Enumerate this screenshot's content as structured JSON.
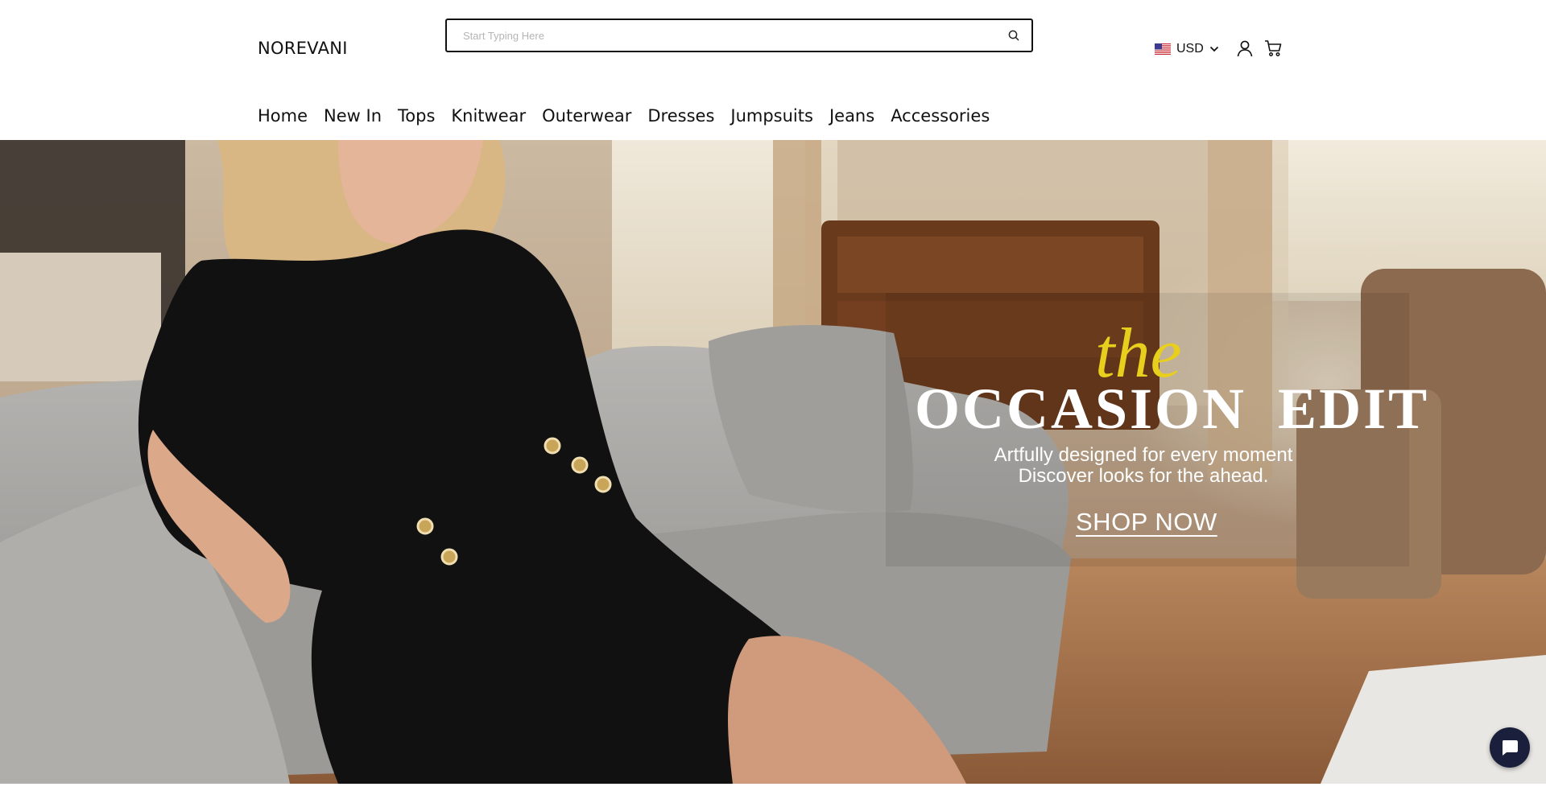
{
  "header": {
    "logo": "NOREVANI",
    "search": {
      "placeholder": "Start Typing Here",
      "value": "",
      "icon": "search-icon"
    },
    "currency": {
      "label": "USD",
      "flag": "us-flag-icon"
    },
    "icons": [
      "user-icon",
      "cart-icon"
    ]
  },
  "nav": {
    "items": [
      {
        "label": "Home"
      },
      {
        "label": "New In"
      },
      {
        "label": "Tops"
      },
      {
        "label": "Knitwear"
      },
      {
        "label": "Outerwear"
      },
      {
        "label": "Dresses"
      },
      {
        "label": "Jumpsuits"
      },
      {
        "label": "Jeans"
      },
      {
        "label": "Accessories"
      }
    ]
  },
  "hero": {
    "kicker": "the",
    "title": "OCCASION EDIT",
    "subtitle_line1": "Artfully designed for every moment",
    "subtitle_line2": "Discover looks for the ahead.",
    "cta": "SHOP NOW",
    "colors": {
      "kicker": "#e8cf1e",
      "text": "#ffffff"
    }
  },
  "chat": {
    "icon": "chat-bubble-icon",
    "color": "#1a1f3b"
  }
}
